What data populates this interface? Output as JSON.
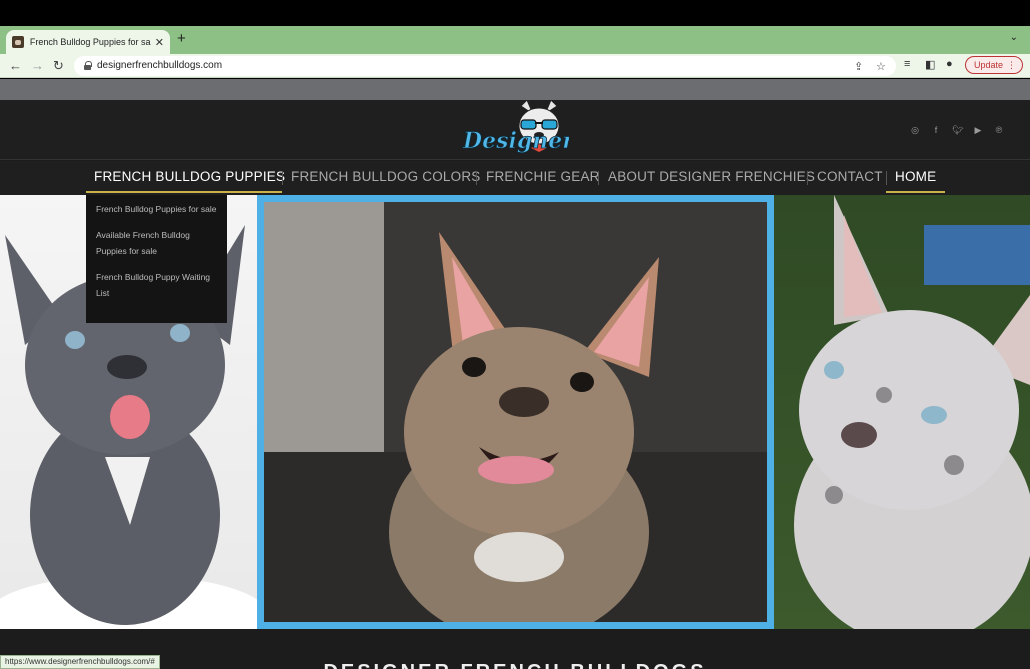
{
  "browser": {
    "tab_title": "French Bulldog Puppies for sale",
    "tab_close": "✕",
    "new_tab": "+",
    "url": "designerfrenchbulldogs.com",
    "update_label": "Update",
    "status_url": "https://www.designerfrenchbulldogs.com/#"
  },
  "site": {
    "logo_text": "Designer",
    "nav": [
      {
        "label": "FRENCH BULLDOG PUPPIES"
      },
      {
        "label": "FRENCH BULLDOG COLORS"
      },
      {
        "label": "FRENCHIE GEAR"
      },
      {
        "label": "ABOUT DESIGNER FRENCHIES"
      },
      {
        "label": "CONTACT"
      },
      {
        "label": "HOME"
      }
    ],
    "dropdown": [
      "French Bulldog Puppies for sale",
      "Available French Bulldog Puppies for sale",
      "French Bulldog Puppy Waiting List"
    ],
    "socials": [
      "instagram-icon",
      "facebook-icon",
      "twitter-icon",
      "youtube-icon",
      "pinterest-icon"
    ],
    "heading_peek": "DESIGNER FRENCH BULLDOGS"
  },
  "colors": {
    "accent_blue": "#4fb0e6",
    "nav_underline": "#c9b24a",
    "tab_strip": "#8cc084"
  }
}
